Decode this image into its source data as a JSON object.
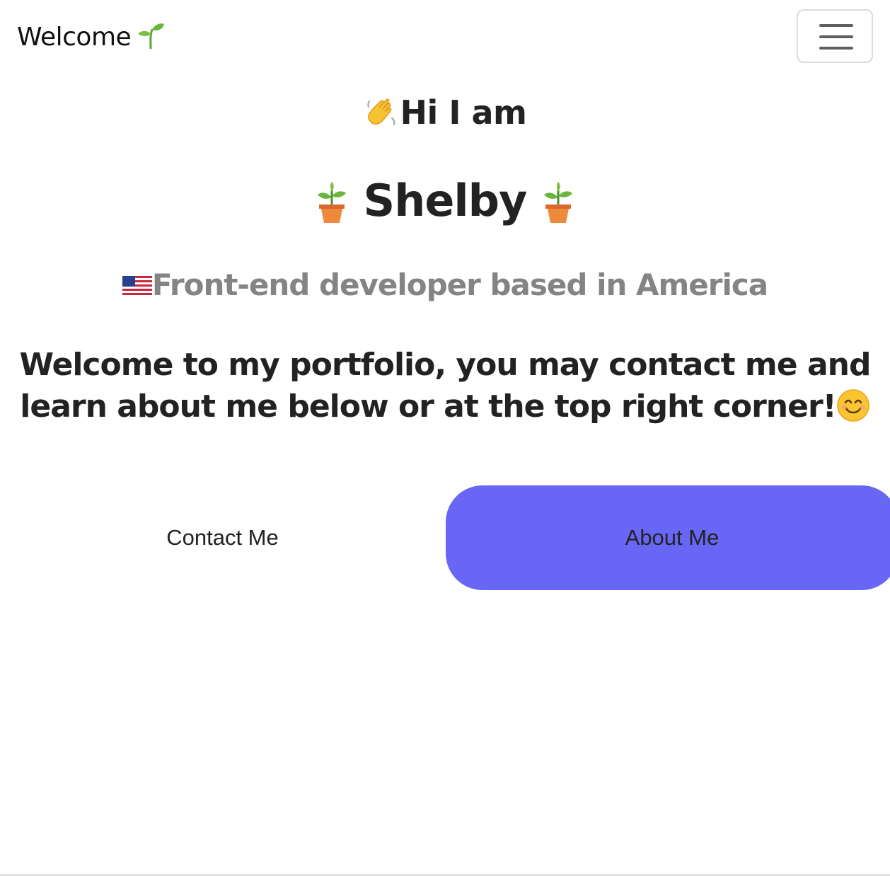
{
  "navbar": {
    "brand_label": "Welcome",
    "brand_icon": "sprout-icon",
    "menu_icon": "hamburger-menu-icon"
  },
  "hero": {
    "greeting": "Hi I am",
    "greeting_icon": "waving-hand-icon",
    "name": "Shelby",
    "name_icon": "potted-plant-icon",
    "role": "Front-end developer based in America",
    "role_icon": "us-flag-icon",
    "intro": "Welcome to my portfolio, you may contact me and learn about me below or at the top right corner!",
    "intro_icon": "smiling-face-icon"
  },
  "actions": {
    "contact_label": "Contact Me",
    "about_label": "About Me"
  },
  "colors": {
    "accent": "#6866f5",
    "text": "#222222",
    "muted_text": "#848484",
    "toggler_border": "#dcdcdc"
  }
}
